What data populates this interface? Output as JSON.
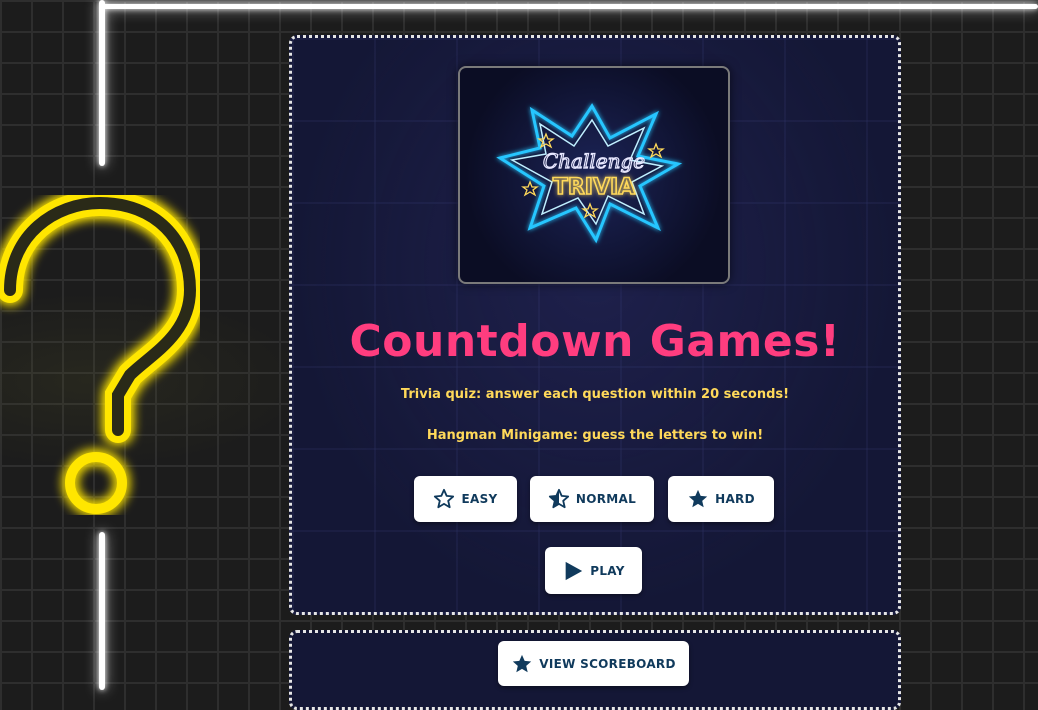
{
  "logo": {
    "line1": "Challenge",
    "line2": "TRIVIA"
  },
  "main": {
    "title": "Countdown Games!",
    "desc1": "Trivia quiz: answer each question within 20 seconds!",
    "desc2": "Hangman Minigame: guess the letters to win!"
  },
  "difficulty": {
    "easy_label": "EASY",
    "normal_label": "NORMAL",
    "hard_label": "HARD"
  },
  "actions": {
    "play_label": "PLAY",
    "scoreboard_label": "VIEW SCOREBOARD"
  },
  "icons": {
    "easy": "star-outline-icon",
    "normal": "star-half-icon",
    "hard": "star-filled-icon",
    "play": "play-icon",
    "scoreboard": "star-filled-icon"
  },
  "colors": {
    "title": "#ff3d7f",
    "subtitle": "#ffd95a",
    "button_text": "#103a5c",
    "neon_yellow": "#ffe600",
    "neon_cyan": "#27c6ff"
  }
}
